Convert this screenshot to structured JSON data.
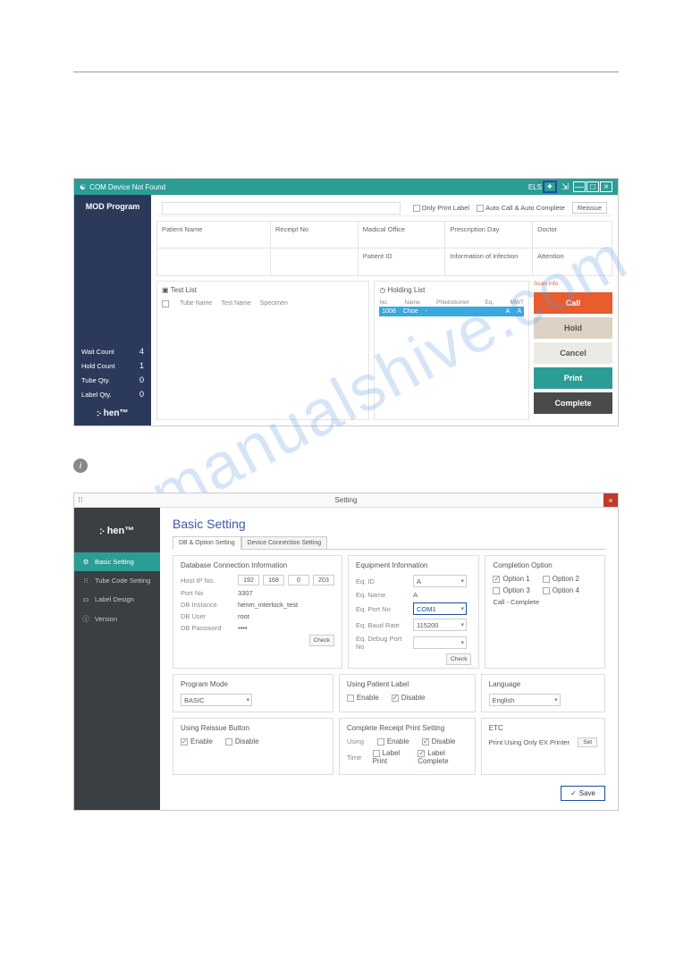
{
  "watermark": "manualshive.com",
  "info_icon": "i",
  "app1": {
    "titlebar": {
      "status": "COM Device Not Found",
      "right_label": "ELS"
    },
    "optbar": {
      "only_print": "Only Print Label",
      "auto": "Auto Call & Auto Complete",
      "reissue": "Reissue"
    },
    "side": {
      "title": "MOD Program",
      "stats": [
        {
          "label": "Wait Count",
          "value": "4"
        },
        {
          "label": "Hold Count",
          "value": "1"
        },
        {
          "label": "Tube Qty.",
          "value": "0"
        },
        {
          "label": "Label Qty.",
          "value": "0"
        }
      ],
      "brand": "჻ hen™"
    },
    "info": {
      "r1": [
        "Patient Name",
        "Receipt No",
        "Madical Office",
        "Prescription Day",
        "Doctor"
      ],
      "r2": [
        "",
        "",
        "Patient ID",
        "Information of infection",
        "Attention"
      ]
    },
    "test": {
      "title": "▣ Test List",
      "cols": [
        "Tube Name",
        "Test Name",
        "Specimen"
      ]
    },
    "hold": {
      "title": "◷ Holding List",
      "head": [
        "No.",
        "Name",
        "Phlebotomet",
        "Eq.",
        "MWT"
      ],
      "row": [
        "1008",
        "Choe",
        "-",
        "A",
        "A"
      ]
    },
    "actions": {
      "scan": "Scan info",
      "call": "Call",
      "hold": "Hold",
      "cancel": "Cancel",
      "print": "Print",
      "complete": "Complete"
    }
  },
  "app2": {
    "title": "Setting",
    "brand": "჻ hen™",
    "nav": [
      {
        "icon": "⚙",
        "label": "Basic Setting",
        "active": true
      },
      {
        "icon": "⁝⁝",
        "label": "Tube Code Setting"
      },
      {
        "icon": "▭",
        "label": "Label Design"
      },
      {
        "icon": "ⓘ",
        "label": "Version"
      }
    ],
    "heading": "Basic Setting",
    "tabs": [
      "DB & Option Setting",
      "Device Connection Setting"
    ],
    "db": {
      "title": "Database Connection Information",
      "host_l": "Host IP No.",
      "host": [
        "192",
        "168",
        "0",
        "203"
      ],
      "port_l": "Port No",
      "port": "3307",
      "inst_l": "DB Instance",
      "inst": "henm_interlock_test",
      "user_l": "DB User",
      "user": "root",
      "pwd_l": "DB Password",
      "pwd": "••••",
      "check": "Check"
    },
    "eq": {
      "title": "Equipment Information",
      "id_l": "Eq. ID",
      "id": "A",
      "name_l": "Eq. Name",
      "name": "A",
      "port_l": "Eq. Port No",
      "port": "COM1",
      "baud_l": "Eq. Baud Rate",
      "baud": "115200",
      "dbg_l": "Eq. Debug Port No",
      "dbg": "",
      "check": "Check"
    },
    "comp": {
      "title": "Completion Option",
      "o1": "Option 1",
      "o2": "Option 2",
      "o3": "Option 3",
      "o4": "Option 4",
      "cc": "Call - Complete"
    },
    "prog": {
      "title": "Program Mode",
      "val": "BASIC"
    },
    "upl": {
      "title": "Using Patient Label",
      "en": "Enable",
      "dis": "Disable"
    },
    "lang": {
      "title": "Language",
      "val": "English"
    },
    "urb": {
      "title": "Using Reissue Button",
      "en": "Enable",
      "dis": "Disable"
    },
    "crps": {
      "title": "Complete Receipt Print Setting",
      "using_l": "Using",
      "en": "Enable",
      "dis": "Disable",
      "time_l": "Time",
      "lp": "Label Print",
      "lc": "Label Complete"
    },
    "etc": {
      "title": "ETC",
      "txt": "Print Using Only EX Printer",
      "set": "Set"
    },
    "save": "Save"
  }
}
